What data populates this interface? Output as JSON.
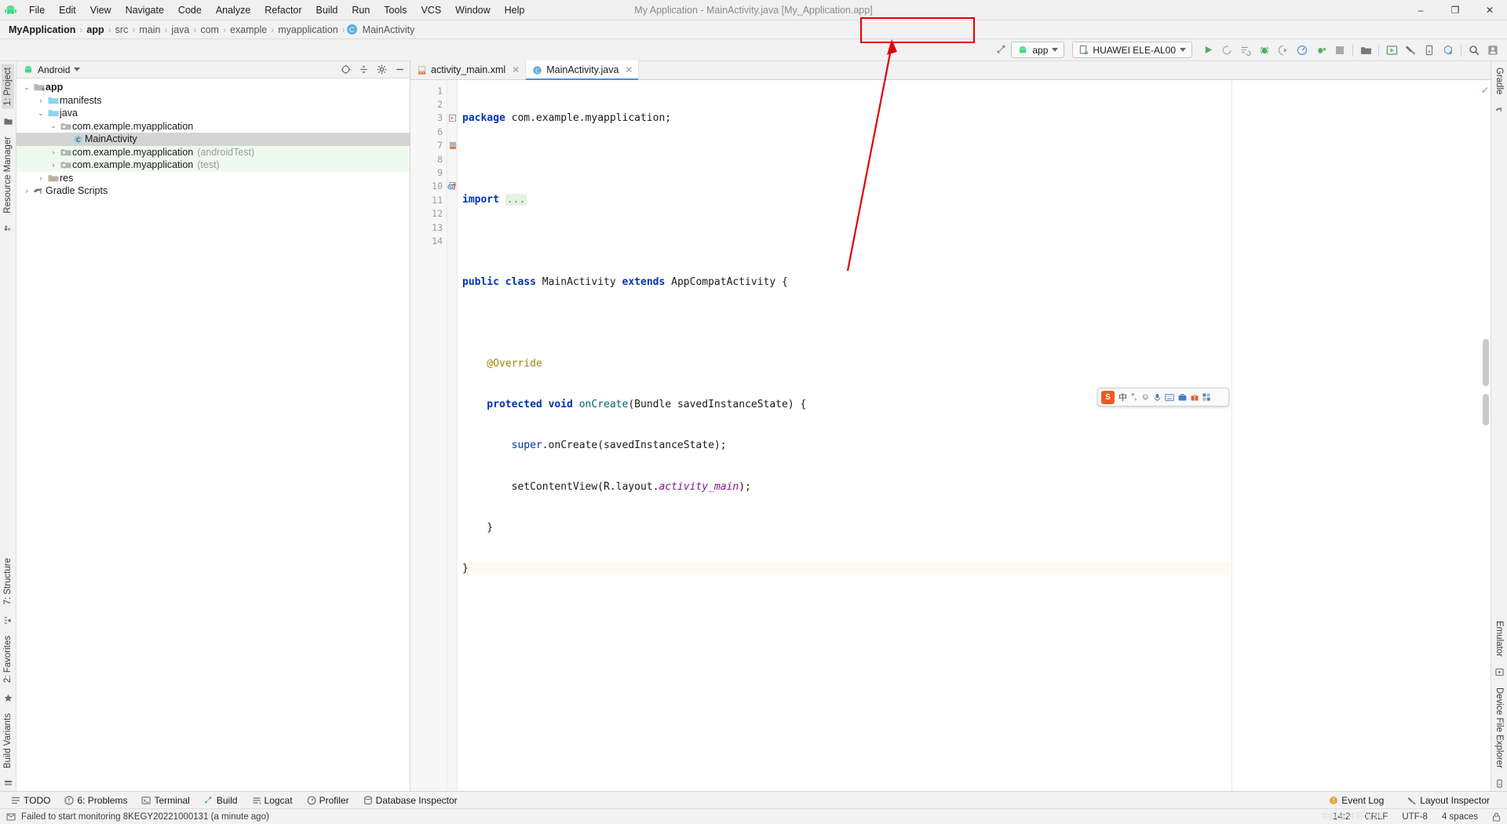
{
  "window": {
    "title": "My Application - MainActivity.java [My_Application.app]",
    "minimize": "–",
    "maximize": "❐",
    "close": "✕"
  },
  "menu": {
    "items": [
      {
        "label": "File"
      },
      {
        "label": "Edit"
      },
      {
        "label": "View"
      },
      {
        "label": "Navigate"
      },
      {
        "label": "Code"
      },
      {
        "label": "Analyze"
      },
      {
        "label": "Refactor"
      },
      {
        "label": "Build"
      },
      {
        "label": "Run"
      },
      {
        "label": "Tools"
      },
      {
        "label": "VCS"
      },
      {
        "label": "Window"
      },
      {
        "label": "Help"
      }
    ]
  },
  "breadcrumb": {
    "items": [
      "MyApplication",
      "app",
      "src",
      "main",
      "java",
      "com",
      "example",
      "myapplication",
      "MainActivity"
    ],
    "class_icon_letter": "C",
    "separator": "›"
  },
  "toolbar": {
    "build_hammer": "build-hammer",
    "run_config": "app",
    "device": "HUAWEI ELE-AL00",
    "icons": [
      "run-icon",
      "rerun-icon",
      "apply-changes-icon",
      "debug-icon",
      "debug-attach-icon",
      "profiler-icon",
      "attach-debugger-icon",
      "stop-icon",
      "sdk-manager-icon",
      "avd-manager-icon",
      "device-manager-icon",
      "layout-inspector-icon",
      "sync-gradle-icon",
      "search-icon",
      "account-icon"
    ]
  },
  "project_panel": {
    "header_title": "Android",
    "header_icons": [
      "select-opened-file-icon",
      "collapse-all-icon",
      "settings-gear-icon",
      "hide-panel-icon"
    ],
    "tree": [
      {
        "label": "app",
        "suffix": "",
        "depth": 0,
        "arrow": "⌄",
        "icon": "module-folder-icon",
        "bold": true,
        "selected": false,
        "test": false
      },
      {
        "label": "manifests",
        "suffix": "",
        "depth": 1,
        "arrow": "›",
        "icon": "folder-icon",
        "bold": false,
        "selected": false,
        "test": false
      },
      {
        "label": "java",
        "suffix": "",
        "depth": 1,
        "arrow": "⌄",
        "icon": "folder-icon",
        "bold": false,
        "selected": false,
        "test": false
      },
      {
        "label": "com.example.myapplication",
        "suffix": "",
        "depth": 2,
        "arrow": "⌄",
        "icon": "package-icon",
        "bold": false,
        "selected": false,
        "test": false
      },
      {
        "label": "MainActivity",
        "suffix": "",
        "depth": 3,
        "arrow": "",
        "icon": "java-class-icon",
        "bold": false,
        "selected": true,
        "test": false
      },
      {
        "label": "com.example.myapplication",
        "suffix": "(androidTest)",
        "depth": 2,
        "arrow": "›",
        "icon": "package-icon",
        "bold": false,
        "selected": false,
        "test": true
      },
      {
        "label": "com.example.myapplication",
        "suffix": "(test)",
        "depth": 2,
        "arrow": "›",
        "icon": "package-icon",
        "bold": false,
        "selected": false,
        "test": true
      },
      {
        "label": "res",
        "suffix": "",
        "depth": 1,
        "arrow": "›",
        "icon": "res-folder-icon",
        "bold": false,
        "selected": false,
        "test": false
      },
      {
        "label": "Gradle Scripts",
        "suffix": "",
        "depth": 0,
        "arrow": "›",
        "icon": "gradle-icon",
        "bold": false,
        "selected": false,
        "test": false
      }
    ]
  },
  "editor": {
    "tabs": [
      {
        "label": "activity_main.xml",
        "icon": "xml-layout-icon",
        "active": false
      },
      {
        "label": "MainActivity.java",
        "icon": "java-class-icon",
        "active": true
      }
    ],
    "line_numbers": [
      "1",
      "2",
      "3",
      "6",
      "7",
      "8",
      "9",
      "10",
      "11",
      "12",
      "13",
      "14"
    ],
    "code_lines": [
      [
        {
          "t": "package ",
          "c": "kw"
        },
        {
          "t": "com.example.myapplication;",
          "c": "plain"
        }
      ],
      [],
      [
        {
          "t": "import ",
          "c": "kw"
        },
        {
          "t": "...",
          "c": "fold-ph"
        }
      ],
      [],
      [
        {
          "t": "public ",
          "c": "kw"
        },
        {
          "t": "class ",
          "c": "kw"
        },
        {
          "t": "MainActivity ",
          "c": "plain"
        },
        {
          "t": "extends ",
          "c": "kw"
        },
        {
          "t": "AppCompatActivity ",
          "c": "plain"
        },
        {
          "t": "{",
          "c": "plain"
        }
      ],
      [],
      [
        {
          "t": "    @Override",
          "c": "ann"
        }
      ],
      [
        {
          "t": "    protected ",
          "c": "kw"
        },
        {
          "t": "void ",
          "c": "kw"
        },
        {
          "t": "onCreate",
          "c": "meth"
        },
        {
          "t": "(Bundle savedInstanceState) {",
          "c": "plain"
        }
      ],
      [
        {
          "t": "        super",
          "c": "kw2"
        },
        {
          "t": ".onCreate(savedInstanceState);",
          "c": "plain"
        }
      ],
      [
        {
          "t": "        setContentView(R.layout.",
          "c": "plain"
        },
        {
          "t": "activity_main",
          "c": "ital"
        },
        {
          "t": ");",
          "c": "plain"
        }
      ],
      [
        {
          "t": "    }",
          "c": "plain"
        }
      ],
      [
        {
          "t": "}",
          "c": "plain"
        }
      ]
    ],
    "current_line_index": 11,
    "inspection_status": "✓",
    "gutter_marks": {
      "line7": "layout-relation-icon",
      "line10": "override-method-icon"
    }
  },
  "left_tool_windows": [
    {
      "label": "1: Project",
      "active": true,
      "icon": "project-icon"
    },
    {
      "label": "Resource Manager",
      "active": false,
      "icon": "resource-manager-icon"
    },
    {
      "label": "7: Structure",
      "active": false,
      "icon": "structure-icon"
    },
    {
      "label": "2: Favorites",
      "active": false,
      "icon": "favorites-star-icon"
    },
    {
      "label": "Build Variants",
      "active": false,
      "icon": "build-variants-icon"
    }
  ],
  "right_tool_windows": [
    {
      "label": "Gradle",
      "icon": "gradle-icon"
    },
    {
      "label": "Emulator",
      "icon": "emulator-icon"
    },
    {
      "label": "Device File Explorer",
      "icon": "device-file-explorer-icon"
    }
  ],
  "bottom_bar": {
    "tabs": [
      {
        "label": "TODO",
        "icon": "todo-icon"
      },
      {
        "label": "6: Problems",
        "icon": "problems-icon"
      },
      {
        "label": "Terminal",
        "icon": "terminal-icon"
      },
      {
        "label": "Build",
        "icon": "build-hammer-icon"
      },
      {
        "label": "Logcat",
        "icon": "logcat-icon"
      },
      {
        "label": "Profiler",
        "icon": "profiler-icon"
      },
      {
        "label": "Database Inspector",
        "icon": "database-inspector-icon"
      }
    ],
    "right_items": [
      {
        "label": "Event Log",
        "icon": "event-log-icon"
      },
      {
        "label": "Layout Inspector",
        "icon": "layout-inspector-icon"
      }
    ]
  },
  "status_bar": {
    "message": "Failed to start monitoring 8KEGY20221000131 (a minute ago)",
    "message_icon": "notification-icon",
    "caret_position": "14:2",
    "line_separator": "CRLF",
    "encoding": "UTF-8",
    "indent": "4 spaces",
    "lock_icon": "lock-icon"
  },
  "ime_bar": {
    "logo": "S",
    "mode": "中",
    "items": [
      "pinyin-toggle",
      "emoji-icon",
      "voice-icon",
      "keyboard-icon",
      "toolbox-icon",
      "gift-icon",
      "grid-icon"
    ]
  },
  "annotation": {
    "type": "red-rectangle-and-arrow",
    "color": "#e00000",
    "target": "device-selector"
  },
  "watermark": "中国软件开发网"
}
